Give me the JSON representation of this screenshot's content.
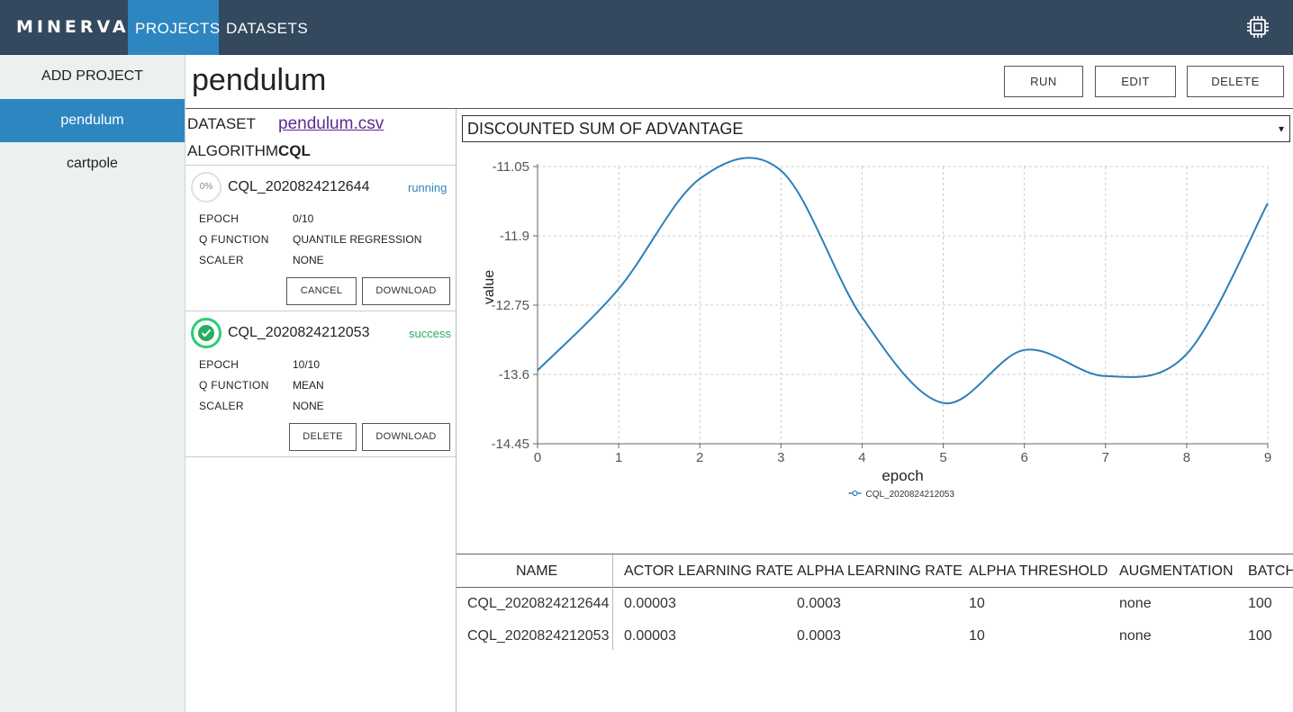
{
  "app": {
    "brand": "MINERVA",
    "nav": [
      {
        "label": "PROJECTS",
        "active": true
      },
      {
        "label": "DATASETS",
        "active": false
      }
    ],
    "chip_icon": "cpu-chip-icon"
  },
  "sidebar": {
    "add_label": "ADD PROJECT",
    "items": [
      {
        "label": "pendulum",
        "active": true
      },
      {
        "label": "cartpole",
        "active": false
      }
    ]
  },
  "project": {
    "title": "pendulum",
    "buttons": {
      "run": "RUN",
      "edit": "EDIT",
      "delete": "DELETE"
    },
    "dataset_label": "DATASET",
    "dataset_value": "pendulum.csv",
    "algorithm_label": "ALGORITHM",
    "algorithm_value": "CQL"
  },
  "experiments": [
    {
      "name": "CQL_2020824212644",
      "status": "running",
      "progress": "0%",
      "fields": [
        {
          "key": "EPOCH",
          "value": "0/10"
        },
        {
          "key": "Q FUNCTION",
          "value": "QUANTILE REGRESSION"
        },
        {
          "key": "SCALER",
          "value": "NONE"
        }
      ],
      "buttons": [
        "CANCEL",
        "DOWNLOAD"
      ]
    },
    {
      "name": "CQL_2020824212053",
      "status": "success",
      "fields": [
        {
          "key": "EPOCH",
          "value": "10/10"
        },
        {
          "key": "Q FUNCTION",
          "value": "MEAN"
        },
        {
          "key": "SCALER",
          "value": "NONE"
        }
      ],
      "buttons": [
        "DELETE",
        "DOWNLOAD"
      ]
    }
  ],
  "colors": {
    "topbar": "#34495e",
    "accent": "#2e86c1",
    "running": "#2e86c1",
    "success": "#27ae60",
    "line": "#2e7fb8"
  },
  "metric": {
    "selected": "DISCOUNTED SUM OF ADVANTAGE"
  },
  "chart_data": {
    "type": "line",
    "xlabel": "epoch",
    "ylabel": "value",
    "x": [
      0,
      1,
      2,
      3,
      4,
      5,
      6,
      7,
      8,
      9
    ],
    "series": [
      {
        "name": "CQL_2020824212053",
        "values": [
          -13.55,
          -12.55,
          -11.2,
          -11.1,
          -12.9,
          -13.95,
          -13.3,
          -13.62,
          -13.35,
          -11.5
        ]
      }
    ],
    "yticks": [
      "-11.05",
      "-11.9",
      "-12.75",
      "-13.6",
      "-14.45"
    ],
    "ylim": [
      -14.45,
      -11.05
    ],
    "xlim": [
      0,
      9
    ],
    "grid": true,
    "legend": "bottom-center"
  },
  "table": {
    "columns": [
      "NAME",
      "ACTOR LEARNING RATE",
      "ALPHA LEARNING RATE",
      "ALPHA THRESHOLD",
      "AUGMENTATION",
      "BATCH"
    ],
    "rows": [
      [
        "CQL_2020824212644",
        "0.00003",
        "0.0003",
        "10",
        "none",
        "100"
      ],
      [
        "CQL_2020824212053",
        "0.00003",
        "0.0003",
        "10",
        "none",
        "100"
      ]
    ]
  }
}
